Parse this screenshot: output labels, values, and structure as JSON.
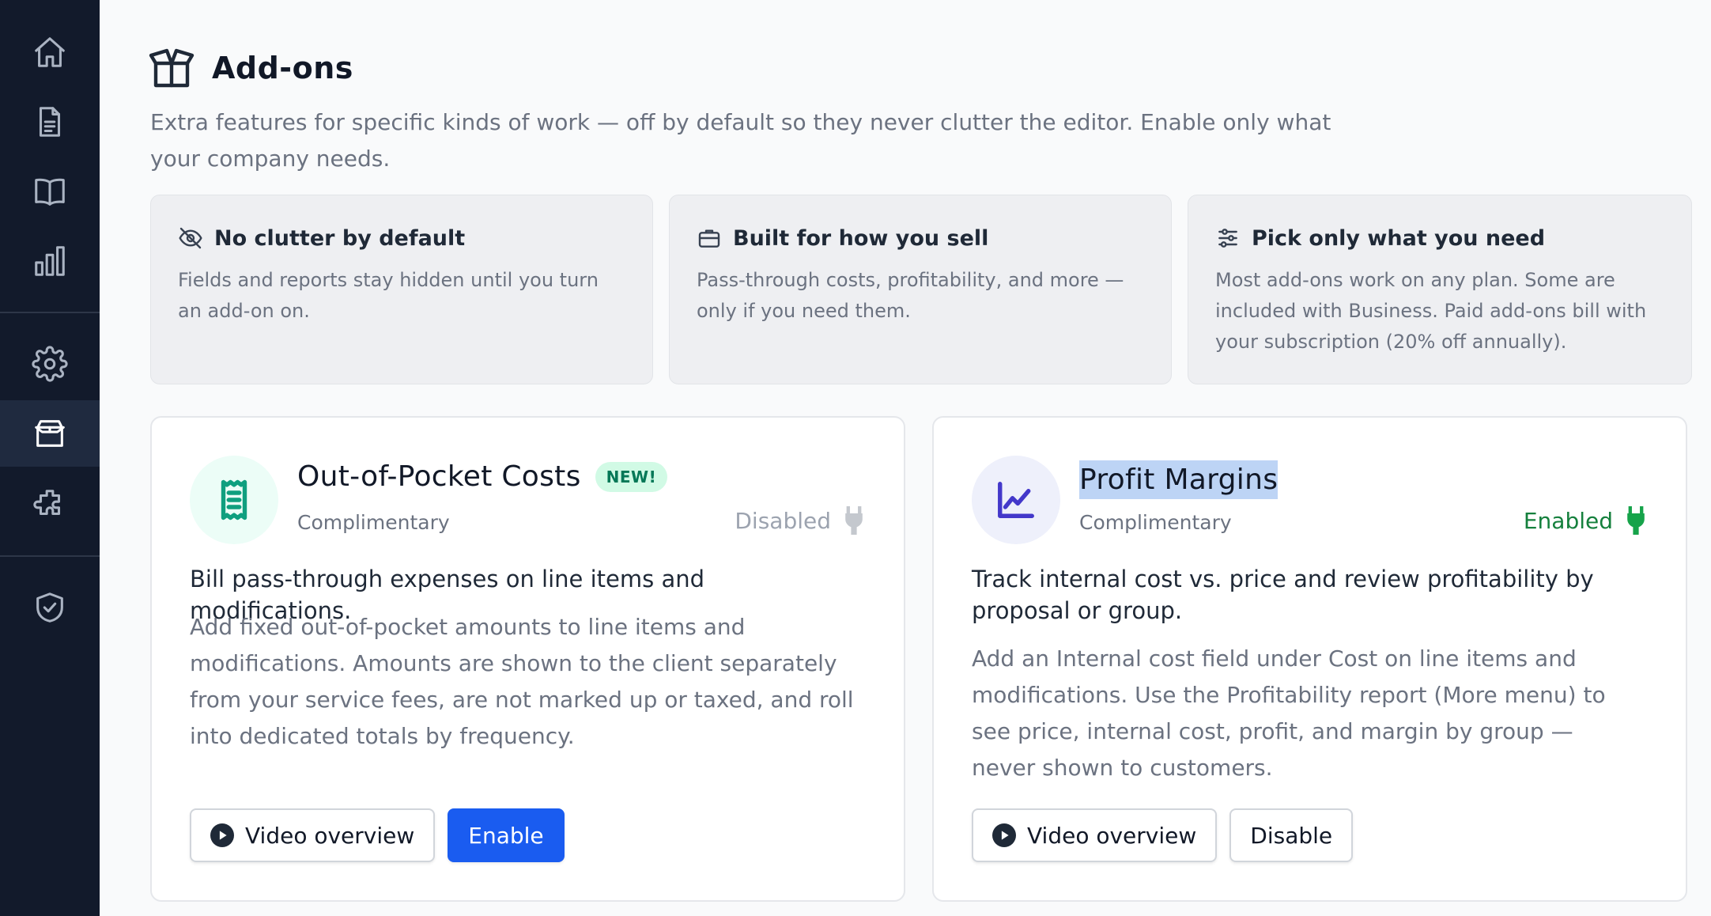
{
  "colors": {
    "sidebar_bg": "#121a2b",
    "accent_blue": "#1a5cf0",
    "enabled_green": "#15803d",
    "badge_green_bg": "#d1fae5"
  },
  "sidebar": {
    "items": [
      {
        "icon": "home-icon",
        "active": false
      },
      {
        "icon": "document-icon",
        "active": false
      },
      {
        "icon": "book-icon",
        "active": false
      },
      {
        "icon": "bar-chart-icon",
        "active": false
      },
      {
        "icon": "gear-icon",
        "active": false
      },
      {
        "icon": "box-icon",
        "active": true
      },
      {
        "icon": "puzzle-icon",
        "active": false
      },
      {
        "icon": "shield-check-icon",
        "active": false
      }
    ]
  },
  "header": {
    "title": "Add-ons",
    "subtitle": "Extra features for specific kinds of work — off by default so they never clutter the editor. Enable only what your company needs."
  },
  "features": [
    {
      "icon": "eye-off-icon",
      "title": "No clutter by default",
      "description": "Fields and reports stay hidden until you turn an add-on on."
    },
    {
      "icon": "briefcase-icon",
      "title": "Built for how you sell",
      "description": "Pass-through costs, profitability, and more — only if you need them."
    },
    {
      "icon": "sliders-icon",
      "title": "Pick only what you need",
      "description": "Most add-ons work on any plan. Some are included with Business. Paid add-ons bill with your subscription (20% off annually)."
    }
  ],
  "addons": [
    {
      "icon": "receipt-icon",
      "title": "Out-of-Pocket Costs",
      "badge": "NEW!",
      "plan": "Complimentary",
      "status": "Disabled",
      "lead": "Bill pass-through expenses on line items and modifications.",
      "description": "Add fixed out-of-pocket amounts to line items and modifications. Amounts are shown to the client separately from your service fees, are not marked up or taxed, and roll into dedicated totals by frequency.",
      "video_label": "Video overview",
      "action_label": "Enable"
    },
    {
      "icon": "line-chart-icon",
      "title": "Profit Margins",
      "plan": "Complimentary",
      "status": "Enabled",
      "lead": "Track internal cost vs. price and review profitability by proposal or group.",
      "description": "Add an Internal cost field under Cost on line items and modifications. Use the Profitability report (More menu) to see price, internal cost, profit, and margin by group — never shown to customers.",
      "video_label": "Video overview",
      "action_label": "Disable"
    }
  ]
}
